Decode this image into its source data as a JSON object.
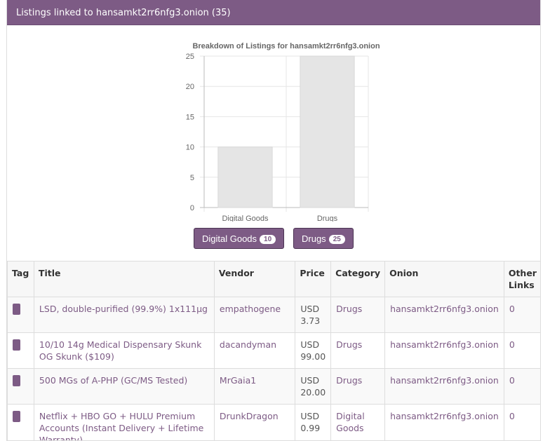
{
  "panel": {
    "title": "Listings linked to hansamkt2rr6nfg3.onion (35)"
  },
  "chart_data": {
    "type": "bar",
    "title": "Breakdown of Listings for hansamkt2rr6nfg3.onion",
    "categories": [
      "Digital Goods",
      "Drugs"
    ],
    "values": [
      10,
      25
    ],
    "ylim": [
      0,
      25
    ],
    "yticks": [
      0,
      5,
      10,
      15,
      20,
      25
    ],
    "grid": true,
    "bar_color": "#e5e5e5"
  },
  "legend": [
    {
      "label": "Digital Goods",
      "count": "10"
    },
    {
      "label": "Drugs",
      "count": "25"
    }
  ],
  "table": {
    "headers": {
      "tag": "Tag",
      "title": "Title",
      "vendor": "Vendor",
      "price": "Price",
      "category": "Category",
      "onion": "Onion",
      "other_links": "Other Links"
    },
    "rows": [
      {
        "title": "LSD, double-purified (99.9%) 1x111µg",
        "vendor": "empathogene",
        "price": "USD 3.73",
        "category": "Drugs",
        "onion": "hansamkt2rr6nfg3.onion",
        "other_links": "0"
      },
      {
        "title": "10/10 14g Medical Dispensary Skunk OG Skunk ($109)",
        "vendor": "dacandyman",
        "price": "USD 99.00",
        "category": "Drugs",
        "onion": "hansamkt2rr6nfg3.onion",
        "other_links": "0"
      },
      {
        "title": "500 MGs of A-PHP (GC/MS Tested)",
        "vendor": "MrGaia1",
        "price": "USD 20.00",
        "category": "Drugs",
        "onion": "hansamkt2rr6nfg3.onion",
        "other_links": "0"
      },
      {
        "title": "Netflix + HBO GO + HULU Premium Accounts (Instant Delivery + Lifetime Warranty)",
        "vendor": "DrunkDragon",
        "price": "USD 0.99",
        "category": "Digital Goods",
        "onion": "hansamkt2rr6nfg3.onion",
        "other_links": "0"
      }
    ]
  },
  "colors": {
    "accent": "#7d5b85",
    "link": "#7d5b85"
  }
}
